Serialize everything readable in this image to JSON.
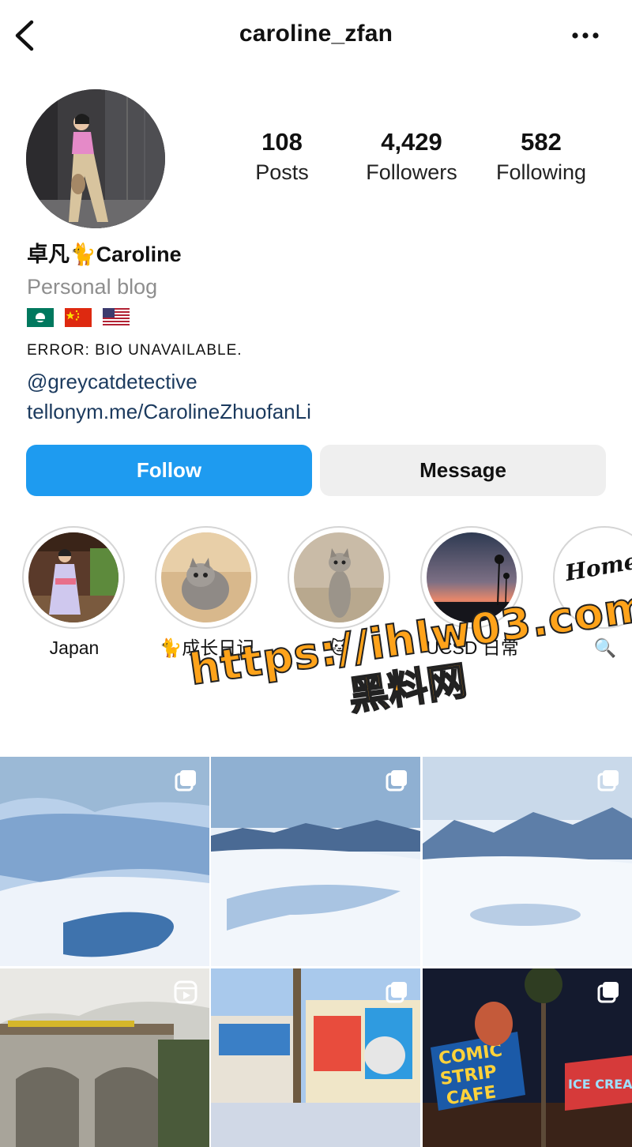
{
  "header": {
    "username": "caroline_zfan",
    "back_icon": "chevron-left-icon",
    "more_icon": "more-horizontal-icon"
  },
  "stats": [
    {
      "value": "108",
      "label": "Posts"
    },
    {
      "value": "4,429",
      "label": "Followers"
    },
    {
      "value": "582",
      "label": "Following"
    }
  ],
  "profile": {
    "display_name": "卓凡🐈Caroline",
    "category": "Personal blog",
    "flags": [
      "macau-flag",
      "china-flag",
      "usa-flag"
    ],
    "bio": "ERROR: BIO UNAVAILABLE.",
    "mention": "@greycatdetective",
    "link": "tellonym.me/CarolineZhuofanLi"
  },
  "buttons": {
    "follow": "Follow",
    "message": "Message",
    "follow_color": "#1e9bf0"
  },
  "highlights": [
    {
      "label": "Japan"
    },
    {
      "label": "🐈成长日记"
    },
    {
      "label": "🐱"
    },
    {
      "label": "UCSD 日常"
    },
    {
      "label": "🔍"
    }
  ],
  "highlight_art_text": "Home Made",
  "watermark": {
    "line1": "https://ihlw03.com",
    "line2": "黑料网"
  },
  "grid": [
    {
      "scene": "snow-glacier-1",
      "badge": "multi-photo-icon"
    },
    {
      "scene": "snow-glacier-2",
      "badge": "multi-photo-icon"
    },
    {
      "scene": "snow-glacier-3",
      "badge": "multi-photo-icon"
    },
    {
      "scene": "model-railway",
      "badge": "reels-icon"
    },
    {
      "scene": "cartoon-building",
      "badge": "multi-photo-icon"
    },
    {
      "scene": "comic-strip-cafe",
      "badge": "multi-photo-icon"
    }
  ],
  "grid_art_text": {
    "cafe_line1": "COMIC",
    "cafe_line2": "STRIP",
    "cafe_line3": "CAFE",
    "cafe_side": "ICE CREAM"
  }
}
